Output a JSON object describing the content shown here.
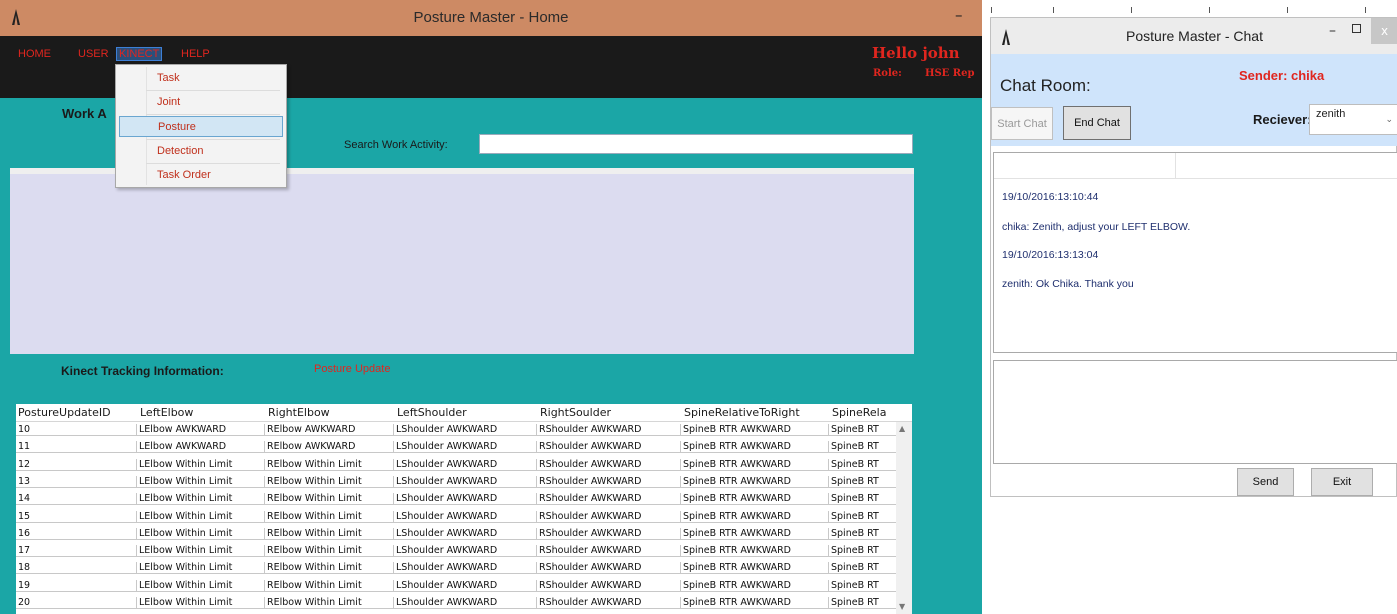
{
  "home": {
    "title": "Posture Master - Home",
    "menu": [
      "HOME",
      "USER",
      "KINECT",
      "HELP"
    ],
    "greeting": "Hello john",
    "role_label": "Role:",
    "role_value": "HSE Rep",
    "dropdown": [
      "Task",
      "Joint",
      "Posture",
      "Detection",
      "Task Order"
    ],
    "dropdown_selected": "Posture",
    "work_label": "Work A",
    "search_label": "Search Work Activity:",
    "search_value": "",
    "tracking_label": "Kinect Tracking Information:",
    "tracking_status": "Posture Update",
    "grid": {
      "columns": [
        "PostureUpdateID",
        "LeftElbow",
        "RightElbow",
        "LeftShoulder",
        "RightSoulder",
        "SpineRelativeToRight",
        "SpineRela"
      ],
      "rows": [
        [
          "10",
          "LElbow AWKWARD",
          "RElbow AWKWARD",
          "LShoulder AWKWARD",
          "RShoulder AWKWARD",
          "SpineB RTR AWKWARD",
          "SpineB RT"
        ],
        [
          "11",
          "LElbow AWKWARD",
          "RElbow AWKWARD",
          "LShoulder AWKWARD",
          "RShoulder AWKWARD",
          "SpineB RTR AWKWARD",
          "SpineB RT"
        ],
        [
          "12",
          "LElbow Within Limit",
          "RElbow Within Limit",
          "LShoulder AWKWARD",
          "RShoulder AWKWARD",
          "SpineB RTR AWKWARD",
          "SpineB RT"
        ],
        [
          "13",
          "LElbow Within Limit",
          "RElbow Within Limit",
          "LShoulder AWKWARD",
          "RShoulder AWKWARD",
          "SpineB RTR AWKWARD",
          "SpineB RT"
        ],
        [
          "14",
          "LElbow Within Limit",
          "RElbow Within Limit",
          "LShoulder AWKWARD",
          "RShoulder AWKWARD",
          "SpineB RTR AWKWARD",
          "SpineB RT"
        ],
        [
          "15",
          "LElbow Within Limit",
          "RElbow Within Limit",
          "LShoulder AWKWARD",
          "RShoulder AWKWARD",
          "SpineB RTR AWKWARD",
          "SpineB RT"
        ],
        [
          "16",
          "LElbow Within Limit",
          "RElbow Within Limit",
          "LShoulder AWKWARD",
          "RShoulder AWKWARD",
          "SpineB RTR AWKWARD",
          "SpineB RT"
        ],
        [
          "17",
          "LElbow Within Limit",
          "RElbow Within Limit",
          "LShoulder AWKWARD",
          "RShoulder AWKWARD",
          "SpineB RTR AWKWARD",
          "SpineB RT"
        ],
        [
          "18",
          "LElbow Within Limit",
          "RElbow Within Limit",
          "LShoulder AWKWARD",
          "RShoulder AWKWARD",
          "SpineB RTR AWKWARD",
          "SpineB RT"
        ],
        [
          "19",
          "LElbow Within Limit",
          "RElbow Within Limit",
          "LShoulder AWKWARD",
          "RShoulder AWKWARD",
          "SpineB RTR AWKWARD",
          "SpineB RT"
        ],
        [
          "20",
          "LElbow Within Limit",
          "RElbow Within Limit",
          "LShoulder AWKWARD",
          "RShoulder AWKWARD",
          "SpineB RTR AWKWARD",
          "SpineB RT"
        ]
      ]
    }
  },
  "chat": {
    "title": "Posture Master - Chat",
    "room_label": "Chat Room:",
    "sender": "Sender: chika",
    "start_label": "Start Chat",
    "end_label": "End Chat",
    "reciever_label": "Reciever:",
    "reciever_value": "zenith",
    "messages": [
      "19/10/2016:13:10:44",
      "chika: Zenith, adjust your LEFT ELBOW.",
      "19/10/2016:13:13:04",
      "zenith: Ok Chika. Thank you"
    ],
    "send_label": "Send",
    "exit_label": "Exit",
    "close_glyph": "x",
    "minimize_glyph": "–"
  },
  "colors": {
    "home_titlebar": "#cd8a64",
    "home_body": "#1ba6a6",
    "menubar": "#1a1a1a",
    "accent_red": "#e0261f",
    "chat_header": "#cfe4fb"
  }
}
